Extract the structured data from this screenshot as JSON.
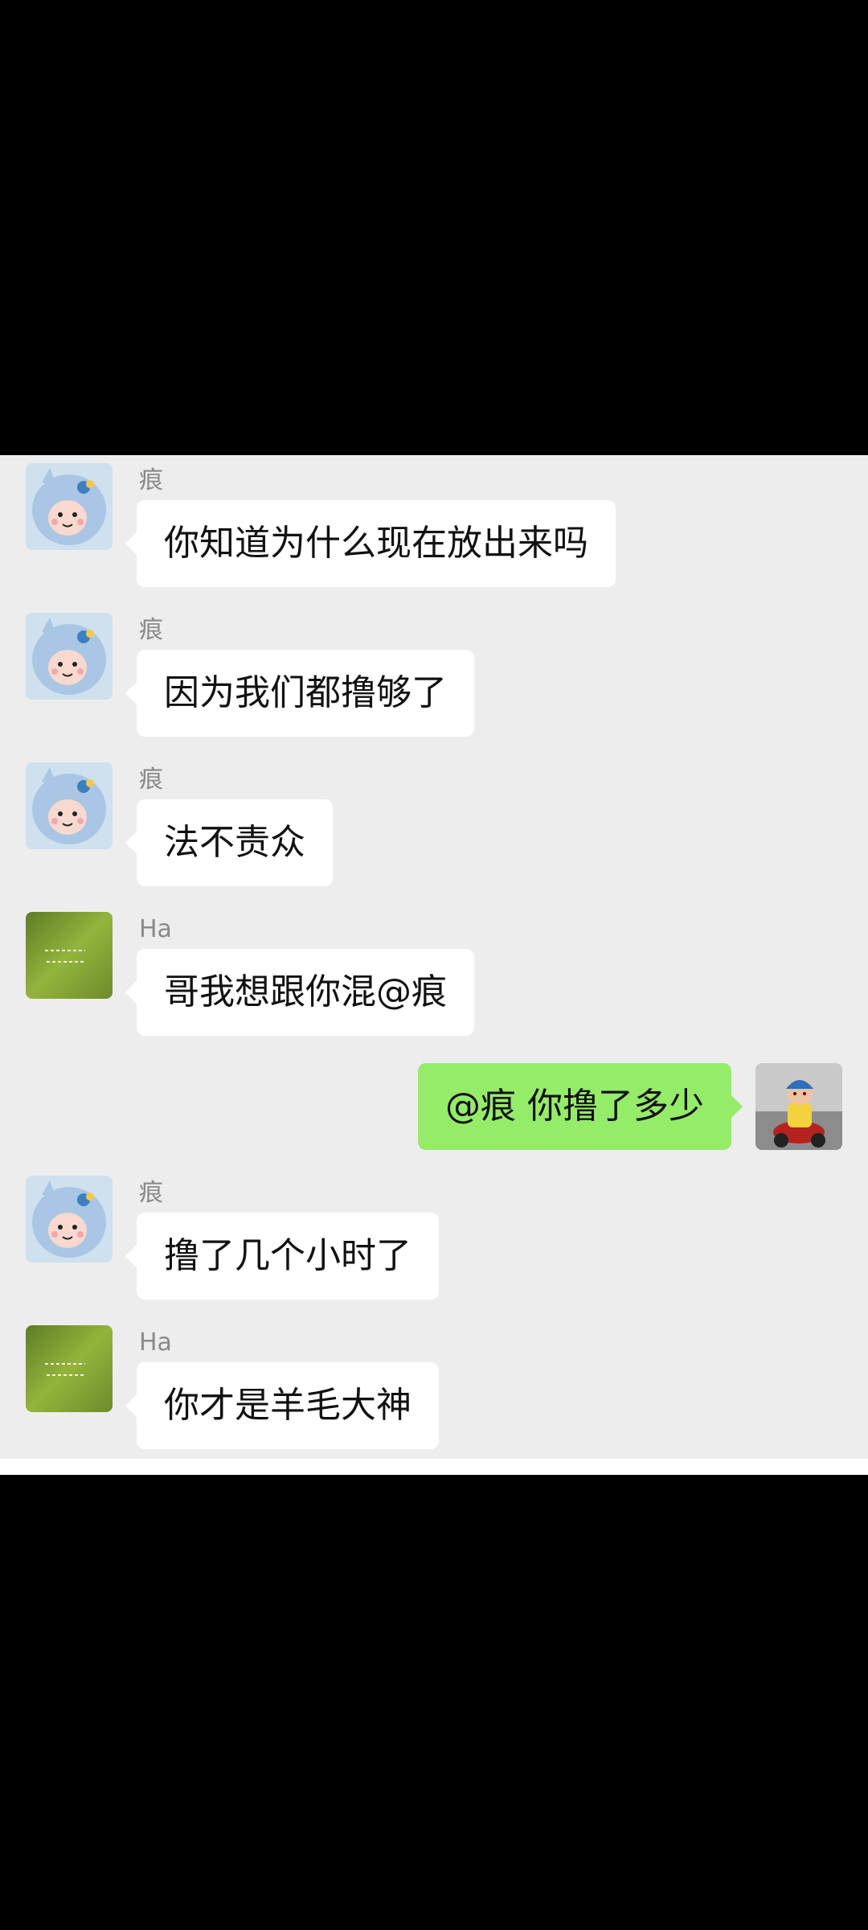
{
  "colors": {
    "chat_background": "#EDEDED",
    "incoming_bubble": "#FFFFFF",
    "outgoing_bubble": "#95EC69",
    "sender_name": "#8A8A8A",
    "message_text": "#111111"
  },
  "messages": [
    {
      "sender": "痕",
      "text": "你知道为什么现在放出来吗",
      "avatar_icon": "plush-toy-avatar-icon",
      "direction": "incoming"
    },
    {
      "sender": "痕",
      "text": "因为我们都撸够了",
      "avatar_icon": "plush-toy-avatar-icon",
      "direction": "incoming"
    },
    {
      "sender": "痕",
      "text": "法不责众",
      "avatar_icon": "plush-toy-avatar-icon",
      "direction": "incoming"
    },
    {
      "sender": "Ha",
      "text": "哥我想跟你混@痕",
      "avatar_icon": "green-grass-avatar-icon",
      "direction": "incoming"
    },
    {
      "sender": "",
      "text": "@痕  你撸了多少",
      "avatar_icon": "scooter-rider-avatar-icon",
      "direction": "outgoing"
    },
    {
      "sender": "痕",
      "text": "撸了几个小时了",
      "avatar_icon": "plush-toy-avatar-icon",
      "direction": "incoming"
    },
    {
      "sender": "Ha",
      "text": "你才是羊毛大神",
      "avatar_icon": "green-grass-avatar-icon",
      "direction": "incoming"
    }
  ]
}
